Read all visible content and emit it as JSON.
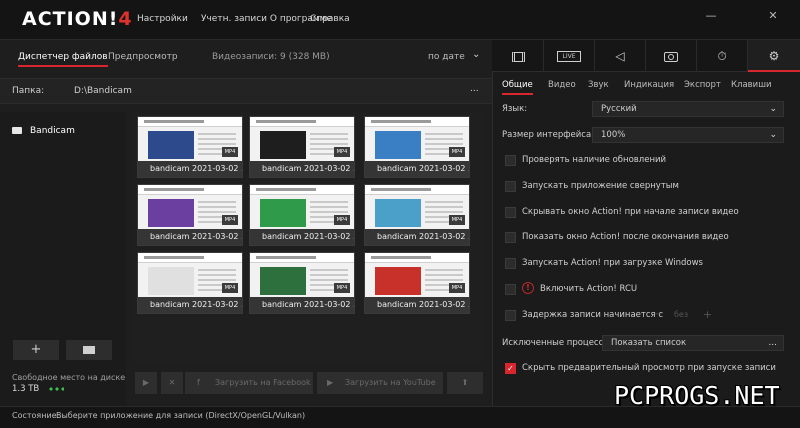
{
  "app": {
    "logo_main": "ACTION!",
    "logo_version": "4"
  },
  "menu": {
    "settings": "Настройки",
    "accounts_about": "Учетн. записи  О программе",
    "help": "Справка"
  },
  "window_controls": {
    "minimize": "—",
    "close": "✕"
  },
  "left": {
    "tabs": {
      "files": "Диспетчер файлов",
      "preview": "Предпросмотр"
    },
    "recordings_count": "Видеозаписи: 9 (328 MB)",
    "sort": "по дате",
    "folder_label": "Папка:",
    "folder_path": "D:\\Bandicam",
    "folder_more": "...",
    "tree_item": "Bandicam",
    "thumbnails": [
      {
        "caption": "bandicam 2021-03-02 ...",
        "badge": "MP4",
        "color": "#2c4a8c"
      },
      {
        "caption": "bandicam 2021-03-02 ...",
        "badge": "MP4",
        "color": "#1e1e1e"
      },
      {
        "caption": "bandicam 2021-03-02 ...",
        "badge": "MP4",
        "color": "#3a7fc4"
      },
      {
        "caption": "bandicam 2021-03-02 ...",
        "badge": "MP4",
        "color": "#6a3fa0"
      },
      {
        "caption": "bandicam 2021-03-02 ...",
        "badge": "MP4",
        "color": "#2f9a4a"
      },
      {
        "caption": "bandicam 2021-03-02 ...",
        "badge": "MP4",
        "color": "#4aa0c8"
      },
      {
        "caption": "bandicam 2021-03-02 ...",
        "badge": "MP4",
        "color": "#e0e0e0"
      },
      {
        "caption": "bandicam 2021-03-02 ...",
        "badge": "MP4",
        "color": "#2e6f3e"
      },
      {
        "caption": "bandicam 2021-03-02 ...",
        "badge": "MP4",
        "color": "#c8302a"
      }
    ],
    "add_button": "+",
    "free_space_label": "Свободное место на диске",
    "free_space_value": "1.3 TB",
    "upload_facebook": "Загрузить на Facebook",
    "upload_youtube": "Загрузить на YouTube"
  },
  "right": {
    "icon_tabs": {
      "live": "LIVE"
    },
    "settings_tabs": [
      "Общие",
      "Видео",
      "Звук",
      "Индикация",
      "Экспорт",
      "Клавиши"
    ],
    "language_label": "Язык:",
    "language_value": "Русский",
    "ui_size_label": "Размер интерфейса:",
    "ui_size_value": "100%",
    "checkboxes": [
      {
        "label": "Проверять наличие обновлений",
        "checked": false
      },
      {
        "label": "Запускать приложение свернутым",
        "checked": false
      },
      {
        "label": "Скрывать окно Action! при начале записи видео",
        "checked": false
      },
      {
        "label": "Показать окно Action! после окончания видео",
        "checked": false
      },
      {
        "label": "Запускать Action! при загрузке Windows",
        "checked": false
      }
    ],
    "rcu_label": "Включить Action! RCU",
    "delay_label": "Задержка записи начинается с",
    "delay_minus": "—",
    "delay_unit": "без",
    "delay_plus": "+",
    "excluded_label": "Исключенные процессы:",
    "excluded_value": "Показать список",
    "excluded_more": "...",
    "hide_preview_label": "Скрыть предварительный просмотр при запуске записи",
    "hide_preview_mark": "✓"
  },
  "status": {
    "label": "Состояние:",
    "text": "Выберите приложение для записи  (DirectX/OpenGL/Vulkan)"
  },
  "watermark": "PCPROGS.NET",
  "accent": "#d8262e"
}
